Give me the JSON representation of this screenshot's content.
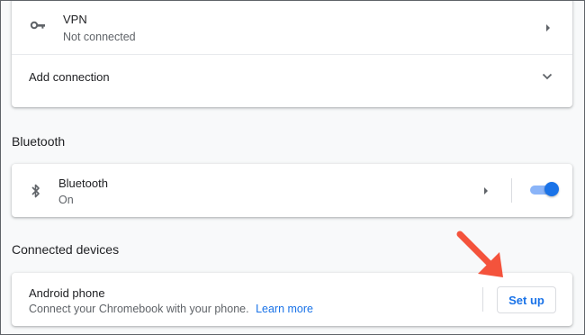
{
  "vpn": {
    "title": "VPN",
    "status": "Not connected",
    "icon": "key-icon"
  },
  "add_connection": {
    "label": "Add connection"
  },
  "bluetooth_section": {
    "title": "Bluetooth"
  },
  "bluetooth": {
    "title": "Bluetooth",
    "status": "On",
    "icon": "bluetooth-icon",
    "enabled": true
  },
  "connected_devices": {
    "title": "Connected devices"
  },
  "android_phone": {
    "title": "Android phone",
    "description": "Connect your Chromebook with your phone.",
    "learn_more": "Learn more",
    "setup_button": "Set up"
  },
  "colors": {
    "accent": "#1a73e8",
    "annotation_arrow": "#f4533c"
  }
}
